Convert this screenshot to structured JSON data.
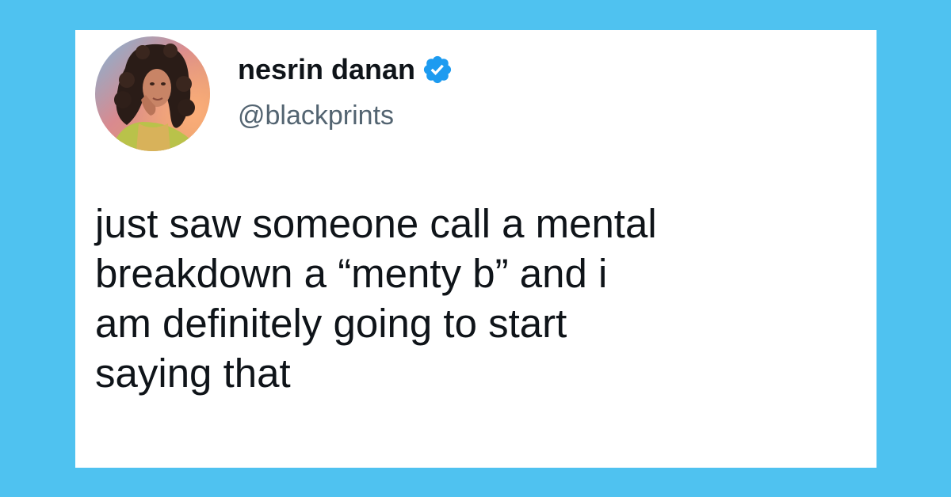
{
  "tweet": {
    "display_name": "nesrin danan",
    "verified": true,
    "handle": "@blackprints",
    "text": "just saw someone call a mental\nbreakdown a “menty b” and i\nam definitely going to start\nsaying that"
  },
  "icons": {
    "verified": "verified-badge-icon",
    "avatar": "profile-photo"
  },
  "colors": {
    "background": "#4fc2f0",
    "card": "#ffffff",
    "text_primary": "#0f1419",
    "text_secondary": "#536471",
    "verified_blue": "#1d9bf0"
  }
}
